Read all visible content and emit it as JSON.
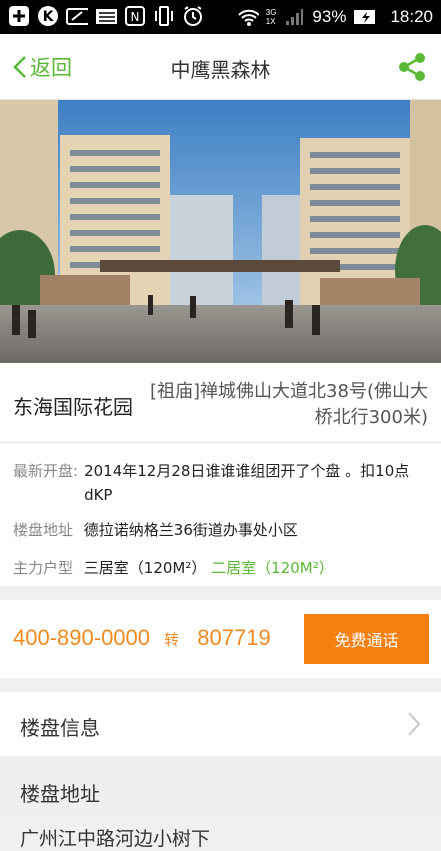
{
  "status": {
    "battery": "93%",
    "time": "18:20",
    "sim1": "3G",
    "sim2": "1X"
  },
  "nav": {
    "back_label": "返回",
    "title": "中鹰黑森林"
  },
  "listing": {
    "name": "东海国际花园",
    "address": "[祖庙]禅城佛山大道北38号(佛山大桥北行300米)"
  },
  "details": [
    {
      "label": "最新开盘:",
      "value": "2014年12月28日谁谁谁组团开了个盘 。扣10点dKP"
    },
    {
      "label": "楼盘地址",
      "value": "德拉诺纳格兰36街道办事处小区"
    },
    {
      "label": "主力户型",
      "value": "三居室（120M²）",
      "value2": "二居室（120M²）"
    }
  ],
  "contact": {
    "phone": "400-890-0000",
    "transfer": "转",
    "ext": "807719",
    "call_label": "免费通话"
  },
  "sections": {
    "info": "楼盘信息",
    "address": "楼盘地址",
    "address_partial": "广州江中路河边小树下"
  },
  "colors": {
    "accent_green": "#5bb936",
    "accent_orange": "#f77f10",
    "green_text": "#5bb936"
  }
}
